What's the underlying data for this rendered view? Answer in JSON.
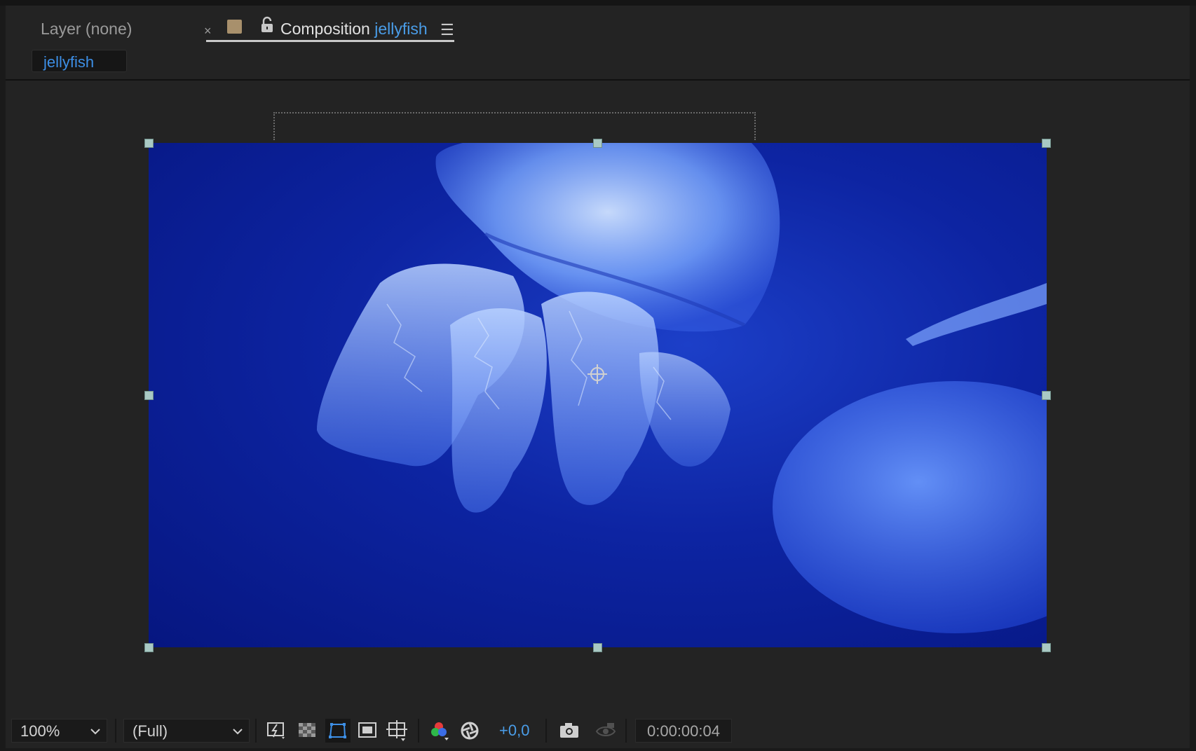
{
  "tabs": {
    "layer_label": "Layer (none)",
    "close_symbol": "×",
    "comp_prefix": "Composition",
    "comp_name": "jellyfish",
    "menu_symbol": "☰",
    "label_color": "#a8906c"
  },
  "breadcrumb": {
    "label": "jellyfish"
  },
  "toolbar": {
    "zoom_value": "100%",
    "resolution_value": "(Full)",
    "exposure_value": "+0,0",
    "timecode": "0:00:00:04",
    "icons": [
      "fast-preview-icon",
      "transparency-grid-icon",
      "mask-path-visibility-icon",
      "region-of-interest-icon",
      "grid-guides-icon",
      "color-channels-icon",
      "color-management-icon",
      "snapshot-icon",
      "show-snapshot-icon"
    ]
  },
  "colors": {
    "accent_blue": "#4a9de8",
    "panel_bg": "#232323",
    "handle": "#a9c9c4"
  }
}
